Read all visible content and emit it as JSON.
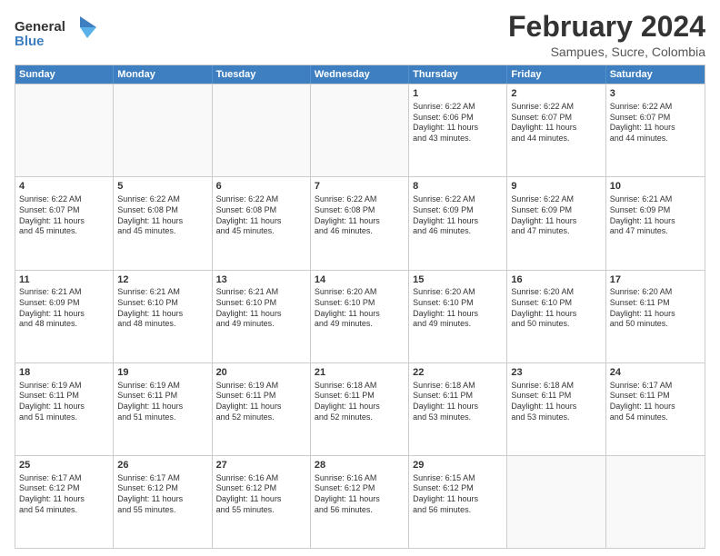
{
  "logo": {
    "line1": "General",
    "line2": "Blue"
  },
  "title": "February 2024",
  "subtitle": "Sampues, Sucre, Colombia",
  "header_days": [
    "Sunday",
    "Monday",
    "Tuesday",
    "Wednesday",
    "Thursday",
    "Friday",
    "Saturday"
  ],
  "weeks": [
    [
      {
        "day": "",
        "info": ""
      },
      {
        "day": "",
        "info": ""
      },
      {
        "day": "",
        "info": ""
      },
      {
        "day": "",
        "info": ""
      },
      {
        "day": "1",
        "info": "Sunrise: 6:22 AM\nSunset: 6:06 PM\nDaylight: 11 hours\nand 43 minutes."
      },
      {
        "day": "2",
        "info": "Sunrise: 6:22 AM\nSunset: 6:07 PM\nDaylight: 11 hours\nand 44 minutes."
      },
      {
        "day": "3",
        "info": "Sunrise: 6:22 AM\nSunset: 6:07 PM\nDaylight: 11 hours\nand 44 minutes."
      }
    ],
    [
      {
        "day": "4",
        "info": "Sunrise: 6:22 AM\nSunset: 6:07 PM\nDaylight: 11 hours\nand 45 minutes."
      },
      {
        "day": "5",
        "info": "Sunrise: 6:22 AM\nSunset: 6:08 PM\nDaylight: 11 hours\nand 45 minutes."
      },
      {
        "day": "6",
        "info": "Sunrise: 6:22 AM\nSunset: 6:08 PM\nDaylight: 11 hours\nand 45 minutes."
      },
      {
        "day": "7",
        "info": "Sunrise: 6:22 AM\nSunset: 6:08 PM\nDaylight: 11 hours\nand 46 minutes."
      },
      {
        "day": "8",
        "info": "Sunrise: 6:22 AM\nSunset: 6:09 PM\nDaylight: 11 hours\nand 46 minutes."
      },
      {
        "day": "9",
        "info": "Sunrise: 6:22 AM\nSunset: 6:09 PM\nDaylight: 11 hours\nand 47 minutes."
      },
      {
        "day": "10",
        "info": "Sunrise: 6:21 AM\nSunset: 6:09 PM\nDaylight: 11 hours\nand 47 minutes."
      }
    ],
    [
      {
        "day": "11",
        "info": "Sunrise: 6:21 AM\nSunset: 6:09 PM\nDaylight: 11 hours\nand 48 minutes."
      },
      {
        "day": "12",
        "info": "Sunrise: 6:21 AM\nSunset: 6:10 PM\nDaylight: 11 hours\nand 48 minutes."
      },
      {
        "day": "13",
        "info": "Sunrise: 6:21 AM\nSunset: 6:10 PM\nDaylight: 11 hours\nand 49 minutes."
      },
      {
        "day": "14",
        "info": "Sunrise: 6:20 AM\nSunset: 6:10 PM\nDaylight: 11 hours\nand 49 minutes."
      },
      {
        "day": "15",
        "info": "Sunrise: 6:20 AM\nSunset: 6:10 PM\nDaylight: 11 hours\nand 49 minutes."
      },
      {
        "day": "16",
        "info": "Sunrise: 6:20 AM\nSunset: 6:10 PM\nDaylight: 11 hours\nand 50 minutes."
      },
      {
        "day": "17",
        "info": "Sunrise: 6:20 AM\nSunset: 6:11 PM\nDaylight: 11 hours\nand 50 minutes."
      }
    ],
    [
      {
        "day": "18",
        "info": "Sunrise: 6:19 AM\nSunset: 6:11 PM\nDaylight: 11 hours\nand 51 minutes."
      },
      {
        "day": "19",
        "info": "Sunrise: 6:19 AM\nSunset: 6:11 PM\nDaylight: 11 hours\nand 51 minutes."
      },
      {
        "day": "20",
        "info": "Sunrise: 6:19 AM\nSunset: 6:11 PM\nDaylight: 11 hours\nand 52 minutes."
      },
      {
        "day": "21",
        "info": "Sunrise: 6:18 AM\nSunset: 6:11 PM\nDaylight: 11 hours\nand 52 minutes."
      },
      {
        "day": "22",
        "info": "Sunrise: 6:18 AM\nSunset: 6:11 PM\nDaylight: 11 hours\nand 53 minutes."
      },
      {
        "day": "23",
        "info": "Sunrise: 6:18 AM\nSunset: 6:11 PM\nDaylight: 11 hours\nand 53 minutes."
      },
      {
        "day": "24",
        "info": "Sunrise: 6:17 AM\nSunset: 6:11 PM\nDaylight: 11 hours\nand 54 minutes."
      }
    ],
    [
      {
        "day": "25",
        "info": "Sunrise: 6:17 AM\nSunset: 6:12 PM\nDaylight: 11 hours\nand 54 minutes."
      },
      {
        "day": "26",
        "info": "Sunrise: 6:17 AM\nSunset: 6:12 PM\nDaylight: 11 hours\nand 55 minutes."
      },
      {
        "day": "27",
        "info": "Sunrise: 6:16 AM\nSunset: 6:12 PM\nDaylight: 11 hours\nand 55 minutes."
      },
      {
        "day": "28",
        "info": "Sunrise: 6:16 AM\nSunset: 6:12 PM\nDaylight: 11 hours\nand 56 minutes."
      },
      {
        "day": "29",
        "info": "Sunrise: 6:15 AM\nSunset: 6:12 PM\nDaylight: 11 hours\nand 56 minutes."
      },
      {
        "day": "",
        "info": ""
      },
      {
        "day": "",
        "info": ""
      }
    ]
  ]
}
